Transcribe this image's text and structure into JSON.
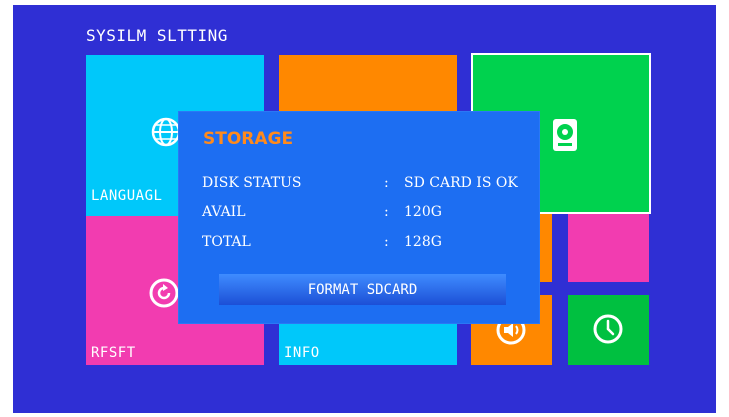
{
  "screen": {
    "title": "SYSILM SLTTING"
  },
  "tiles": {
    "language": {
      "label": "LANGUAGL",
      "color": "#00c8fa",
      "icon": "globe-icon"
    },
    "orange_top": {
      "color": "#ff8800"
    },
    "storage": {
      "color": "#00d24e",
      "icon": "hard-disk-icon"
    },
    "reset": {
      "label": "RFSFT",
      "color": "#f23cb0",
      "icon": "reset-icon"
    },
    "info": {
      "label": "INFO",
      "color": "#00c8fa"
    },
    "pink_small": {
      "color": "#f23cb0"
    },
    "volume": {
      "color": "#ff8800",
      "icon": "volume-icon"
    },
    "clock": {
      "color": "#00c040",
      "icon": "clock-icon"
    }
  },
  "dialog": {
    "title": "STORAGE",
    "rows": [
      {
        "key": "DISK STATUS",
        "sep": ":",
        "value": "SD CARD IS OK"
      },
      {
        "key": "AVAIL",
        "sep": ":",
        "value": "120G"
      },
      {
        "key": "TOTAL",
        "sep": ":",
        "value": "128G"
      }
    ],
    "button_label": "FORMAT SDCARD",
    "accent": "#ff8a1c",
    "background": "#1d6ef2"
  }
}
